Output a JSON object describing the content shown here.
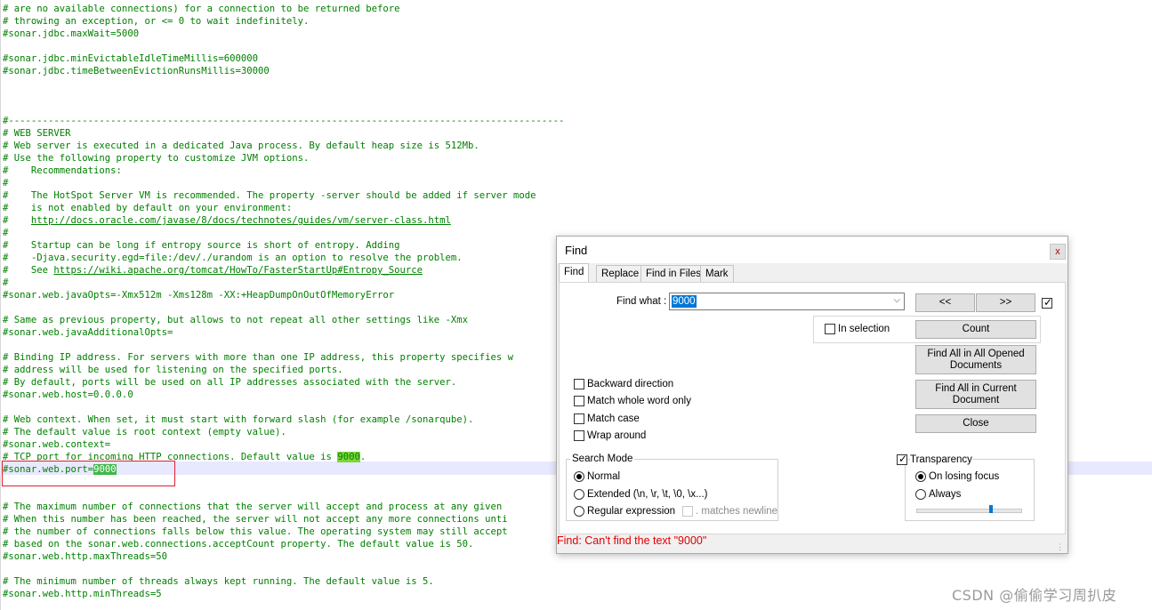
{
  "editor": {
    "lines": [
      {
        "id": "l0",
        "text": "# are no available connections) for a connection to be returned before"
      },
      {
        "id": "l1",
        "text": "# throwing an exception, or <= 0 to wait indefinitely."
      },
      {
        "id": "l2",
        "text": "#sonar.jdbc.maxWait=5000"
      },
      {
        "id": "l3",
        "text": "#sonar.jdbc.minEvictableIdleTimeMillis=600000"
      },
      {
        "id": "l4",
        "text": "#sonar.jdbc.timeBetweenEvictionRunsMillis=30000"
      },
      {
        "id": "l5",
        "text": "#--------------------------------------------------------------------------------------------------"
      },
      {
        "id": "l6",
        "text": "# WEB SERVER"
      },
      {
        "id": "l7",
        "text": "# Web server is executed in a dedicated Java process. By default heap size is 512Mb."
      },
      {
        "id": "l8",
        "text": "# Use the following property to customize JVM options."
      },
      {
        "id": "l9",
        "text": "#    Recommendations:"
      },
      {
        "id": "l10",
        "text": "#"
      },
      {
        "id": "l11",
        "text": "#    The HotSpot Server VM is recommended. The property -server should be added if server mode"
      },
      {
        "id": "l12",
        "text": "#    is not enabled by default on your environment:"
      },
      {
        "id": "l13a",
        "text": "#    "
      },
      {
        "id": "l13b",
        "text": "http://docs.oracle.com/javase/8/docs/technotes/guides/vm/server-class.html"
      },
      {
        "id": "l14",
        "text": "#"
      },
      {
        "id": "l15",
        "text": "#    Startup can be long if entropy source is short of entropy. Adding"
      },
      {
        "id": "l16",
        "text": "#    -Djava.security.egd=file:/dev/./urandom is an option to resolve the problem."
      },
      {
        "id": "l17a",
        "text": "#    See "
      },
      {
        "id": "l17b",
        "text": "https://wiki.apache.org/tomcat/HowTo/FasterStartUp#Entropy_Source"
      },
      {
        "id": "l18",
        "text": "#"
      },
      {
        "id": "l19",
        "text": "#sonar.web.javaOpts=-Xmx512m -Xms128m -XX:+HeapDumpOnOutOfMemoryError"
      },
      {
        "id": "l20",
        "text": "# Same as previous property, but allows to not repeat all other settings like -Xmx"
      },
      {
        "id": "l21",
        "text": "#sonar.web.javaAdditionalOpts="
      },
      {
        "id": "l22",
        "text": "# Binding IP address. For servers with more than one IP address, this property specifies w"
      },
      {
        "id": "l23",
        "text": "# address will be used for listening on the specified ports."
      },
      {
        "id": "l24",
        "text": "# By default, ports will be used on all IP addresses associated with the server."
      },
      {
        "id": "l25",
        "text": "#sonar.web.host=0.0.0.0"
      },
      {
        "id": "l26",
        "text": "# Web context. When set, it must start with forward slash (for example /sonarqube)."
      },
      {
        "id": "l27",
        "text": "# The default value is root context (empty value)."
      },
      {
        "id": "l28",
        "text": "#sonar.web.context="
      },
      {
        "id": "l29a",
        "text": "# TCP port for incoming HTTP connections. Default value is "
      },
      {
        "id": "l29b",
        "text": "9000"
      },
      {
        "id": "l29c",
        "text": "."
      },
      {
        "id": "l30a",
        "text": "#sonar.web.port="
      },
      {
        "id": "l30b",
        "text": "9000"
      },
      {
        "id": "l31",
        "text": "# The maximum number of connections that the server will accept and process at any given"
      },
      {
        "id": "l32",
        "text": "# When this number has been reached, the server will not accept any more connections unti"
      },
      {
        "id": "l33",
        "text": "# the number of connections falls below this value. The operating system may still accept"
      },
      {
        "id": "l34",
        "text": "# based on the sonar.web.connections.acceptCount property. The default value is 50."
      },
      {
        "id": "l35",
        "text": "#sonar.web.http.maxThreads=50"
      },
      {
        "id": "l36",
        "text": "# The minimum number of threads always kept running. The default value is 5."
      },
      {
        "id": "l37",
        "text": "#sonar.web.http.minThreads=5"
      }
    ]
  },
  "watermark": "CSDN @偷偷学习周扒皮",
  "find_dialog": {
    "title": "Find",
    "close_glyph": "x",
    "tabs": [
      "Find",
      "Replace",
      "Find in Files",
      "Mark"
    ],
    "find_what_label": "Find what :",
    "find_what_value": "9000",
    "prev_button": "<<",
    "next_button": ">>",
    "in_selection": "In selection",
    "count_button": "Count",
    "find_all_opened_1": "Find All in All Opened",
    "find_all_opened_2": "Documents",
    "find_all_current_1": "Find All in Current",
    "find_all_current_2": "Document",
    "close_button": "Close",
    "backward": "Backward direction",
    "whole_word": "Match whole word only",
    "match_case": "Match case",
    "wrap_around": "Wrap around",
    "search_mode_title": "Search Mode",
    "mode_normal": "Normal",
    "mode_extended": "Extended (\\n, \\r, \\t, \\0, \\x...)",
    "mode_regex": "Regular expression",
    "matches_newline": ". matches newline",
    "transparency": "Transparency",
    "on_losing_focus": "On losing focus",
    "always": "Always",
    "status": "Find: Can't find the text \"9000\""
  }
}
